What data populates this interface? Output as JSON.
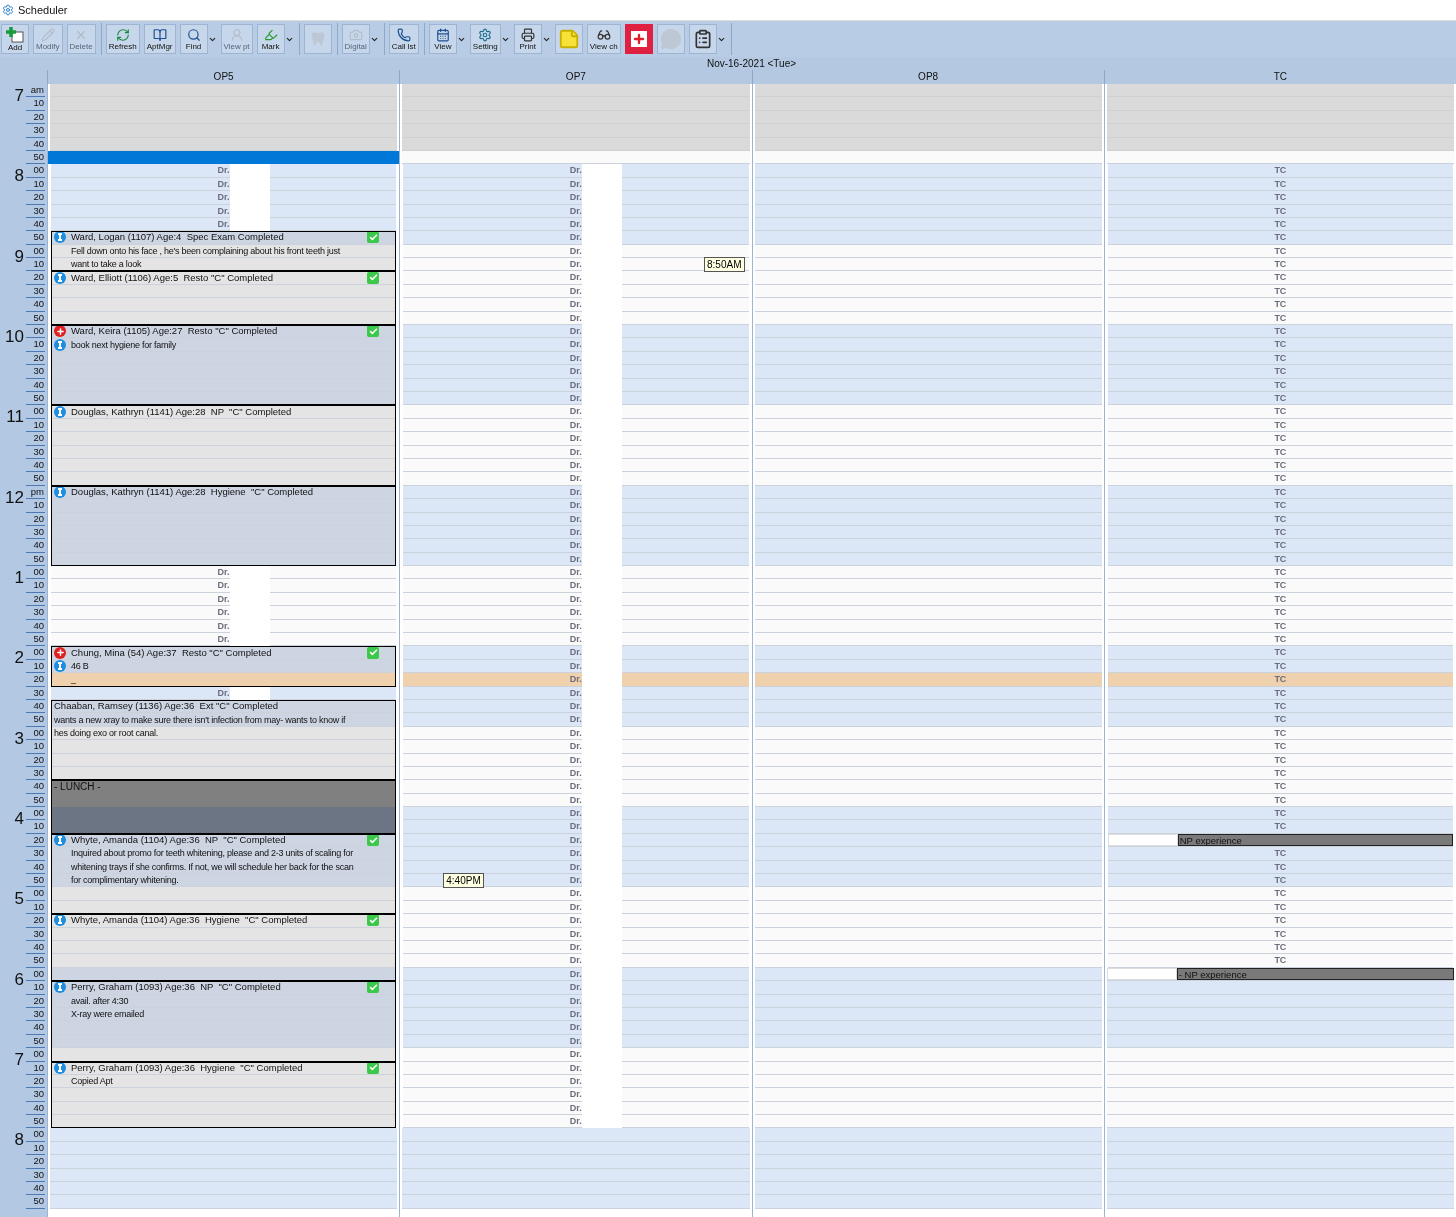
{
  "window": {
    "title": "Scheduler"
  },
  "toolbar": [
    {
      "items": [
        {
          "label": "Add",
          "disabled": false,
          "dropdown": false
        },
        {
          "label": "Modify",
          "disabled": true,
          "dropdown": false
        },
        {
          "label": "Delete",
          "disabled": true,
          "dropdown": false
        }
      ]
    },
    {
      "items": [
        {
          "label": "Refresh",
          "disabled": false,
          "dropdown": false
        },
        {
          "label": "AptMgr",
          "disabled": false,
          "dropdown": false
        },
        {
          "label": "Find",
          "disabled": false,
          "dropdown": true
        },
        {
          "label": "View pt",
          "disabled": true,
          "dropdown": false
        },
        {
          "label": "Mark",
          "disabled": false,
          "dropdown": true
        }
      ]
    },
    {
      "items": [
        {
          "disabled": true,
          "dropdown": false
        }
      ]
    },
    {
      "items": [
        {
          "label": "Digital",
          "disabled": true,
          "dropdown": true
        }
      ]
    },
    {
      "items": [
        {
          "label": "Call lst",
          "disabled": false,
          "dropdown": false
        }
      ]
    },
    {
      "items": [
        {
          "label": "View",
          "disabled": false,
          "dropdown": true
        },
        {
          "label": "Setting",
          "disabled": false,
          "dropdown": true
        },
        {
          "label": "Print",
          "disabled": false,
          "dropdown": true
        },
        {
          "disabled": false,
          "dropdown": false
        },
        {
          "label": "View ch",
          "disabled": false,
          "dropdown": false
        },
        {
          "disabled": false,
          "dropdown": false,
          "highlighted": true
        },
        {
          "disabled": true,
          "dropdown": false
        },
        {
          "disabled": false,
          "dropdown": true
        }
      ]
    }
  ],
  "date": "Nov-16-2021 <Tue>",
  "time_axis": [
    {
      "hour": "7",
      "minutes": [
        "am",
        "10",
        "20",
        "30",
        "40",
        "50"
      ]
    },
    {
      "hour": "8",
      "minutes": [
        "00",
        "10",
        "20",
        "30",
        "40",
        "50"
      ]
    },
    {
      "hour": "9",
      "minutes": [
        "00",
        "10",
        "20",
        "30",
        "40",
        "50"
      ]
    },
    {
      "hour": "10",
      "minutes": [
        "00",
        "10",
        "20",
        "30",
        "40",
        "50"
      ]
    },
    {
      "hour": "11",
      "minutes": [
        "00",
        "10",
        "20",
        "30",
        "40",
        "50"
      ]
    },
    {
      "hour": "12",
      "minutes": [
        "pm",
        "10",
        "20",
        "30",
        "40",
        "50"
      ]
    },
    {
      "hour": "1",
      "minutes": [
        "00",
        "10",
        "20",
        "30",
        "40",
        "50"
      ]
    },
    {
      "hour": "2",
      "minutes": [
        "00",
        "10",
        "20",
        "30",
        "40",
        "50"
      ]
    },
    {
      "hour": "3",
      "minutes": [
        "00",
        "10",
        "20",
        "30",
        "40",
        "50"
      ]
    },
    {
      "hour": "4",
      "minutes": [
        "00",
        "10",
        "20",
        "30",
        "40",
        "50"
      ]
    },
    {
      "hour": "5",
      "minutes": [
        "00",
        "10",
        "20",
        "30",
        "40",
        "50"
      ]
    },
    {
      "hour": "6",
      "minutes": [
        "00",
        "10",
        "20",
        "30",
        "40",
        "50"
      ]
    },
    {
      "hour": "7",
      "minutes": [
        "00",
        "10",
        "20",
        "30",
        "40",
        "50"
      ]
    },
    {
      "hour": "8",
      "minutes": [
        "00",
        "10",
        "20",
        "30",
        "40",
        "50"
      ]
    }
  ],
  "columns": [
    {
      "header": "OP5",
      "blocks": [
        {
          "kind": "closed",
          "rows": [
            {
              "shaded": false
            },
            {
              "shaded": false
            },
            {
              "shaded": false
            },
            {
              "shaded": false
            },
            {
              "shaded": false
            }
          ]
        },
        {
          "kind": "bar",
          "rows": [
            {
              "shaded": false
            }
          ]
        },
        {
          "kind": "provider",
          "outlined": false,
          "redacted": true,
          "rows": [
            {
              "label": "Dr.",
              "shaded": true
            },
            {
              "label": "Dr.",
              "shaded": true
            },
            {
              "label": "Dr.",
              "shaded": true
            },
            {
              "label": "Dr.",
              "shaded": true
            },
            {
              "label": "Dr.",
              "shaded": true
            }
          ]
        },
        {
          "kind": "appointment",
          "title": "Ward, Logan (1107) Age:4  Spec Exam Completed",
          "notes": [
            "Fell down onto his face , he's been complaining about his front teeth just",
            "want to take a look"
          ],
          "alerts": [
            {
              "kind": "info"
            }
          ],
          "completed": true,
          "rows": [
            {
              "shaded": true
            },
            {
              "shaded": false
            },
            {
              "shaded": false
            }
          ]
        },
        {
          "kind": "appointment",
          "title": "Ward, Elliott (1106) Age:5  Resto \"C\" Completed",
          "alerts": [
            {
              "kind": "info"
            }
          ],
          "completed": true,
          "rows": [
            {
              "shaded": false
            },
            {
              "shaded": false
            },
            {
              "shaded": false
            },
            {
              "shaded": false
            }
          ]
        },
        {
          "kind": "appointment",
          "title": "Ward, Keira (1105) Age:27  Resto \"C\" Completed",
          "notes": [
            "book next hygiene for family"
          ],
          "alerts": [
            {
              "kind": "medical"
            },
            {
              "kind": "info"
            }
          ],
          "completed": true,
          "rows": [
            {
              "shaded": true
            },
            {
              "shaded": true
            },
            {
              "shaded": true
            },
            {
              "shaded": true
            },
            {
              "shaded": true
            },
            {
              "shaded": true
            }
          ]
        },
        {
          "kind": "appointment",
          "title": "Douglas, Kathryn (1141) Age:28  NP  \"C\" Completed",
          "alerts": [
            {
              "kind": "info"
            }
          ],
          "completed": false,
          "rows": [
            {
              "shaded": false
            },
            {
              "shaded": false
            },
            {
              "shaded": false
            },
            {
              "shaded": false
            },
            {
              "shaded": false
            },
            {
              "shaded": false
            }
          ]
        },
        {
          "kind": "appointment",
          "title": "Douglas, Kathryn (1141) Age:28  Hygiene  \"C\" Completed",
          "alerts": [
            {
              "kind": "info"
            }
          ],
          "completed": false,
          "rows": [
            {
              "shaded": true
            },
            {
              "shaded": true
            },
            {
              "shaded": true
            },
            {
              "shaded": true
            },
            {
              "shaded": true
            },
            {
              "shaded": true
            }
          ]
        },
        {
          "kind": "provider",
          "outlined": false,
          "redacted": true,
          "rows": [
            {
              "label": "Dr.",
              "shaded": false
            },
            {
              "label": "Dr.",
              "shaded": false
            },
            {
              "label": "Dr.",
              "shaded": false
            },
            {
              "label": "Dr.",
              "shaded": false
            },
            {
              "label": "Dr.",
              "shaded": false
            },
            {
              "label": "Dr.",
              "shaded": false
            }
          ]
        },
        {
          "kind": "appointment",
          "title": "Chung, Mina (54) Age:37  Resto \"C\" Completed",
          "notes": [
            "46 B",
            "_"
          ],
          "alerts": [
            {
              "kind": "medical"
            },
            {
              "kind": "info"
            }
          ],
          "completed": true,
          "rows": [
            {
              "shaded": true
            },
            {
              "shaded": true
            },
            {
              "shaded": true,
              "current": true
            }
          ]
        },
        {
          "kind": "provider",
          "outlined": false,
          "redacted": true,
          "rows": [
            {
              "label": "Dr.",
              "shaded": true
            }
          ]
        },
        {
          "kind": "appointment",
          "title": "Chaaban, Ramsey (1136) Age:36  Ext \"C\" Completed",
          "notes": [
            "wants a new xray to make sure there isn't infection from may- wants to know if",
            "hes doing exo or root canal."
          ],
          "completed": false,
          "rows": [
            {
              "shaded": true
            },
            {
              "shaded": true
            },
            {
              "shaded": false
            },
            {
              "shaded": false
            },
            {
              "shaded": false
            },
            {
              "shaded": false
            }
          ]
        },
        {
          "kind": "lunch",
          "title": "- LUNCH -",
          "rows": [
            {
              "shaded": false
            },
            {
              "shaded": false
            },
            {
              "shaded": true
            },
            {
              "shaded": true
            }
          ]
        },
        {
          "kind": "appointment",
          "title": "Whyte, Amanda (1104) Age:36  NP  \"C\" Completed",
          "notes": [
            "Inquired about promo for teeth whitening, please and 2-3 units of scaling for",
            "whitening trays if she confirms. If not, we will schedule her back for the scan",
            "for complimentary whitening."
          ],
          "alerts": [
            {
              "kind": "info"
            }
          ],
          "completed": true,
          "rows": [
            {
              "shaded": true
            },
            {
              "shaded": true
            },
            {
              "shaded": true
            },
            {
              "shaded": true
            },
            {
              "shaded": false
            },
            {
              "shaded": false
            }
          ]
        },
        {
          "kind": "appointment",
          "title": "Whyte, Amanda (1104) Age:36  Hygiene  \"C\" Completed",
          "alerts": [
            {
              "kind": "info"
            }
          ],
          "completed": true,
          "rows": [
            {
              "shaded": false
            },
            {
              "shaded": false
            },
            {
              "shaded": false
            },
            {
              "shaded": false
            },
            {
              "shaded": true
            }
          ]
        },
        {
          "kind": "appointment",
          "title": "Perry, Graham (1093) Age:36  NP  \"C\" Completed",
          "notes": [
            "avail. after 4:30",
            "X-ray were emailed"
          ],
          "alerts": [
            {
              "kind": "info"
            }
          ],
          "completed": true,
          "rows": [
            {
              "shaded": true
            },
            {
              "shaded": true
            },
            {
              "shaded": true
            },
            {
              "shaded": true
            },
            {
              "shaded": true
            },
            {
              "shaded": false
            }
          ]
        },
        {
          "kind": "appointment",
          "title": "Perry, Graham (1093) Age:36  Hygiene  \"C\" Completed",
          "notes": [
            "Copied Apt"
          ],
          "alerts": [
            {
              "kind": "info"
            }
          ],
          "completed": true,
          "rows": [
            {
              "shaded": false
            },
            {
              "shaded": false
            },
            {
              "shaded": false
            },
            {
              "shaded": false
            },
            {
              "shaded": false
            }
          ]
        },
        {
          "kind": "open",
          "rows": [
            {
              "shaded": true
            },
            {
              "shaded": true
            },
            {
              "shaded": true
            },
            {
              "shaded": true
            },
            {
              "shaded": true
            },
            {
              "shaded": true
            }
          ]
        }
      ]
    },
    {
      "header": "OP7",
      "blocks": [
        {
          "kind": "closed",
          "rows": [
            {
              "shaded": false
            },
            {
              "shaded": false
            },
            {
              "shaded": false
            },
            {
              "shaded": false
            },
            {
              "shaded": false
            }
          ]
        },
        {
          "kind": "open",
          "rows": [
            {
              "shaded": false
            }
          ]
        },
        {
          "kind": "provider",
          "outlined": true,
          "redacted": true,
          "rows": [
            {
              "label": "Dr.",
              "shaded": true
            },
            {
              "label": "Dr.",
              "shaded": true
            },
            {
              "label": "Dr.",
              "shaded": true
            },
            {
              "label": "Dr.",
              "shaded": true
            },
            {
              "label": "Dr.",
              "shaded": true
            },
            {
              "label": "Dr.",
              "shaded": true
            },
            {
              "label": "Dr.",
              "shaded": false
            },
            {
              "label": "Dr.",
              "shaded": false,
              "tooltip": {
                "text": "8:50AM",
                "kind": "trailing"
              }
            },
            {
              "label": "Dr.",
              "shaded": false
            },
            {
              "label": "Dr.",
              "shaded": false
            },
            {
              "label": "Dr.",
              "shaded": false
            },
            {
              "label": "Dr.",
              "shaded": false
            },
            {
              "label": "Dr.",
              "shaded": true
            },
            {
              "label": "Dr.",
              "shaded": true
            },
            {
              "label": "Dr.",
              "shaded": true
            },
            {
              "label": "Dr.",
              "shaded": true
            },
            {
              "label": "Dr.",
              "shaded": true
            },
            {
              "label": "Dr.",
              "shaded": true
            },
            {
              "label": "Dr.",
              "shaded": false
            },
            {
              "label": "Dr.",
              "shaded": false
            },
            {
              "label": "Dr.",
              "shaded": false
            },
            {
              "label": "Dr.",
              "shaded": false
            },
            {
              "label": "Dr.",
              "shaded": false
            },
            {
              "label": "Dr.",
              "shaded": false
            },
            {
              "label": "Dr.",
              "shaded": true
            },
            {
              "label": "Dr.",
              "shaded": true
            },
            {
              "label": "Dr.",
              "shaded": true
            },
            {
              "label": "Dr.",
              "shaded": true
            },
            {
              "label": "Dr.",
              "shaded": true
            },
            {
              "label": "Dr.",
              "shaded": true
            },
            {
              "label": "Dr.",
              "shaded": false
            },
            {
              "label": "Dr.",
              "shaded": false
            },
            {
              "label": "Dr.",
              "shaded": false
            },
            {
              "label": "Dr.",
              "shaded": false
            },
            {
              "label": "Dr.",
              "shaded": false
            },
            {
              "label": "Dr.",
              "shaded": false
            },
            {
              "label": "Dr.",
              "shaded": true
            },
            {
              "label": "Dr.",
              "shaded": true
            },
            {
              "label": "Dr.",
              "shaded": true,
              "current": true
            },
            {
              "label": "Dr.",
              "shaded": true
            },
            {
              "label": "Dr.",
              "shaded": true
            },
            {
              "label": "Dr.",
              "shaded": true
            },
            {
              "label": "Dr.",
              "shaded": false
            },
            {
              "label": "Dr.",
              "shaded": false
            },
            {
              "label": "Dr.",
              "shaded": false
            },
            {
              "label": "Dr.",
              "shaded": false
            },
            {
              "label": "Dr.",
              "shaded": false
            },
            {
              "label": "Dr.",
              "shaded": false
            },
            {
              "label": "Dr.",
              "shaded": true
            },
            {
              "label": "Dr.",
              "shaded": true
            },
            {
              "label": "Dr.",
              "shaded": true
            },
            {
              "label": "Dr.",
              "shaded": true
            },
            {
              "label": "Dr.",
              "shaded": true
            },
            {
              "label": "Dr.",
              "shaded": true,
              "tooltip": {
                "text": "4:40PM",
                "kind": "leading"
              }
            },
            {
              "label": "Dr.",
              "shaded": false
            },
            {
              "label": "Dr.",
              "shaded": false
            },
            {
              "label": "Dr.",
              "shaded": false
            },
            {
              "label": "Dr.",
              "shaded": false
            },
            {
              "label": "Dr.",
              "shaded": false
            },
            {
              "label": "Dr.",
              "shaded": false
            },
            {
              "label": "Dr.",
              "shaded": true
            },
            {
              "label": "Dr.",
              "shaded": true
            },
            {
              "label": "Dr.",
              "shaded": true
            },
            {
              "label": "Dr.",
              "shaded": true
            },
            {
              "label": "Dr.",
              "shaded": true
            },
            {
              "label": "Dr.",
              "shaded": true
            },
            {
              "label": "Dr.",
              "shaded": false
            },
            {
              "label": "Dr.",
              "shaded": false
            },
            {
              "label": "Dr.",
              "shaded": false
            },
            {
              "label": "Dr.",
              "shaded": false
            },
            {
              "label": "Dr.",
              "shaded": false
            },
            {
              "label": "Dr.",
              "shaded": false
            }
          ]
        },
        {
          "kind": "open",
          "rows": [
            {
              "shaded": true
            },
            {
              "shaded": true
            },
            {
              "shaded": true
            },
            {
              "shaded": true
            },
            {
              "shaded": true
            },
            {
              "shaded": true
            }
          ]
        }
      ]
    },
    {
      "header": "OP8",
      "blocks": [
        {
          "kind": "closed",
          "rows": [
            {
              "shaded": false
            },
            {
              "shaded": false
            },
            {
              "shaded": false
            },
            {
              "shaded": false
            },
            {
              "shaded": false
            }
          ]
        },
        {
          "kind": "open",
          "rows": [
            {
              "shaded": false
            },
            {
              "shaded": true
            },
            {
              "shaded": true
            },
            {
              "shaded": true
            },
            {
              "shaded": true
            },
            {
              "shaded": true
            },
            {
              "shaded": true
            },
            {
              "shaded": false
            },
            {
              "shaded": false
            },
            {
              "shaded": false
            },
            {
              "shaded": false
            },
            {
              "shaded": false
            },
            {
              "shaded": false
            },
            {
              "shaded": true
            },
            {
              "shaded": true
            },
            {
              "shaded": true
            },
            {
              "shaded": true
            },
            {
              "shaded": true
            },
            {
              "shaded": true
            },
            {
              "shaded": false
            },
            {
              "shaded": false
            },
            {
              "shaded": false
            },
            {
              "shaded": false
            },
            {
              "shaded": false
            },
            {
              "shaded": false
            },
            {
              "shaded": true
            },
            {
              "shaded": true
            },
            {
              "shaded": true
            },
            {
              "shaded": true
            },
            {
              "shaded": true
            },
            {
              "shaded": true
            },
            {
              "shaded": false
            },
            {
              "shaded": false
            },
            {
              "shaded": false
            },
            {
              "shaded": false
            },
            {
              "shaded": false
            },
            {
              "shaded": false
            },
            {
              "shaded": true
            },
            {
              "shaded": true
            },
            {
              "shaded": true,
              "current": true
            },
            {
              "shaded": true
            },
            {
              "shaded": true
            },
            {
              "shaded": true
            },
            {
              "shaded": false
            },
            {
              "shaded": false
            },
            {
              "shaded": false
            },
            {
              "shaded": false
            },
            {
              "shaded": false
            },
            {
              "shaded": false
            },
            {
              "shaded": true
            },
            {
              "shaded": true
            },
            {
              "shaded": true
            },
            {
              "shaded": true
            },
            {
              "shaded": true
            },
            {
              "shaded": true
            },
            {
              "shaded": false
            },
            {
              "shaded": false
            },
            {
              "shaded": false
            },
            {
              "shaded": false
            },
            {
              "shaded": false
            },
            {
              "shaded": false
            },
            {
              "shaded": true
            },
            {
              "shaded": true
            },
            {
              "shaded": true
            },
            {
              "shaded": true
            },
            {
              "shaded": true
            },
            {
              "shaded": true
            },
            {
              "shaded": false
            },
            {
              "shaded": false
            },
            {
              "shaded": false
            },
            {
              "shaded": false
            },
            {
              "shaded": false
            },
            {
              "shaded": false
            },
            {
              "shaded": true
            },
            {
              "shaded": true
            },
            {
              "shaded": true
            },
            {
              "shaded": true
            },
            {
              "shaded": true
            },
            {
              "shaded": true
            }
          ]
        }
      ]
    },
    {
      "header": "TC",
      "blocks": [
        {
          "kind": "closed",
          "rows": [
            {
              "shaded": false
            },
            {
              "shaded": false
            },
            {
              "shaded": false
            },
            {
              "shaded": false
            },
            {
              "shaded": false
            }
          ]
        },
        {
          "kind": "open",
          "rows": [
            {
              "shaded": false
            }
          ]
        },
        {
          "kind": "provider",
          "outlined": true,
          "redacted": false,
          "rows": [
            {
              "label": "TC",
              "shaded": true
            },
            {
              "label": "TC",
              "shaded": true
            },
            {
              "label": "TC",
              "shaded": true
            },
            {
              "label": "TC",
              "shaded": true
            },
            {
              "label": "TC",
              "shaded": true
            },
            {
              "label": "TC",
              "shaded": true
            },
            {
              "label": "TC",
              "shaded": false
            },
            {
              "label": "TC",
              "shaded": false
            },
            {
              "label": "TC",
              "shaded": false
            },
            {
              "label": "TC",
              "shaded": false
            },
            {
              "label": "TC",
              "shaded": false
            },
            {
              "label": "TC",
              "shaded": false
            },
            {
              "label": "TC",
              "shaded": true
            },
            {
              "label": "TC",
              "shaded": true
            },
            {
              "label": "TC",
              "shaded": true
            },
            {
              "label": "TC",
              "shaded": true
            },
            {
              "label": "TC",
              "shaded": true
            },
            {
              "label": "TC",
              "shaded": true
            },
            {
              "label": "TC",
              "shaded": false
            },
            {
              "label": "TC",
              "shaded": false
            },
            {
              "label": "TC",
              "shaded": false
            },
            {
              "label": "TC",
              "shaded": false
            },
            {
              "label": "TC",
              "shaded": false
            },
            {
              "label": "TC",
              "shaded": false
            },
            {
              "label": "TC",
              "shaded": true
            },
            {
              "label": "TC",
              "shaded": true
            },
            {
              "label": "TC",
              "shaded": true
            },
            {
              "label": "TC",
              "shaded": true
            },
            {
              "label": "TC",
              "shaded": true
            },
            {
              "label": "TC",
              "shaded": true
            },
            {
              "label": "TC",
              "shaded": false
            },
            {
              "label": "TC",
              "shaded": false
            },
            {
              "label": "TC",
              "shaded": false
            },
            {
              "label": "TC",
              "shaded": false
            },
            {
              "label": "TC",
              "shaded": false
            },
            {
              "label": "TC",
              "shaded": false
            },
            {
              "label": "TC",
              "shaded": true
            },
            {
              "label": "TC",
              "shaded": true
            },
            {
              "label": "TC",
              "shaded": true,
              "current": true
            },
            {
              "label": "TC",
              "shaded": true
            },
            {
              "label": "TC",
              "shaded": true
            },
            {
              "label": "TC",
              "shaded": true
            },
            {
              "label": "TC",
              "shaded": false
            },
            {
              "label": "TC",
              "shaded": false
            },
            {
              "label": "TC",
              "shaded": false
            },
            {
              "label": "TC",
              "shaded": false
            },
            {
              "label": "TC",
              "shaded": false
            },
            {
              "label": "TC",
              "shaded": false
            },
            {
              "label": "TC",
              "shaded": true
            },
            {
              "label": "TC",
              "shaded": true
            },
            {
              "text": "NP experience",
              "redacted": true,
              "shaded": true
            },
            {
              "label": "TC",
              "shaded": true
            },
            {
              "label": "TC",
              "shaded": true
            },
            {
              "label": "TC",
              "shaded": true
            },
            {
              "label": "TC",
              "shaded": false
            },
            {
              "label": "TC",
              "shaded": false
            },
            {
              "label": "TC",
              "shaded": false
            },
            {
              "label": "TC",
              "shaded": false
            },
            {
              "label": "TC",
              "shaded": false
            },
            {
              "label": "TC",
              "shaded": false
            }
          ]
        },
        {
          "kind": "open",
          "rows": [
            {
              "text": "- NP experience",
              "redacted": true,
              "shaded": true
            },
            {
              "shaded": true
            },
            {
              "shaded": true
            },
            {
              "shaded": true
            },
            {
              "shaded": true
            },
            {
              "shaded": true
            },
            {
              "shaded": false
            },
            {
              "shaded": false
            },
            {
              "shaded": false
            },
            {
              "shaded": false
            },
            {
              "shaded": false
            },
            {
              "shaded": false
            },
            {
              "shaded": true
            },
            {
              "shaded": true
            },
            {
              "shaded": true
            },
            {
              "shaded": true
            },
            {
              "shaded": true
            },
            {
              "shaded": true
            }
          ]
        }
      ]
    }
  ]
}
